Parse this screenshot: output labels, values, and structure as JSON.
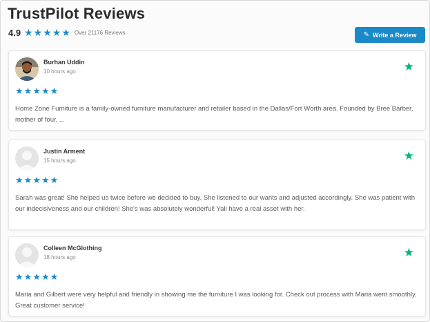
{
  "header": {
    "title": "TrustPilot Reviews",
    "rating": "4.9",
    "rating_stars": 5,
    "review_count": "Over 21176 Reviews",
    "write_button": "Write a Review",
    "write_button_icon": "pencil-icon"
  },
  "colors": {
    "accent": "#1a8ac7",
    "trustpilot_green": "#00b67a"
  },
  "reviews": [
    {
      "name": "Burhan Uddin",
      "time": "10 hours ago",
      "stars": 5,
      "avatar": "photo",
      "text": "Home Zone Furniture is a family-owned furniture manufacturer and retailer based in the Dallas/Fort Worth area. Founded by Bree Barber, mother of four, ..."
    },
    {
      "name": "Justin Arment",
      "time": "15 hours ago",
      "stars": 5,
      "avatar": "placeholder",
      "text": "Sarah was great! She helped us twice before we decided to buy. She listened to our wants and adjusted accordingly. She was patient with our indecisiveness and our children! She's was absolutely wonderful! Yall have a real asset with her."
    },
    {
      "name": "Colleen McGlothing",
      "time": "18 hours ago",
      "stars": 5,
      "avatar": "placeholder",
      "text": "Maria and Gilbert were very helpful and friendly in showing me the furniture I was looking for. Check out process with Maria went smoothly. Great customer service!"
    }
  ]
}
